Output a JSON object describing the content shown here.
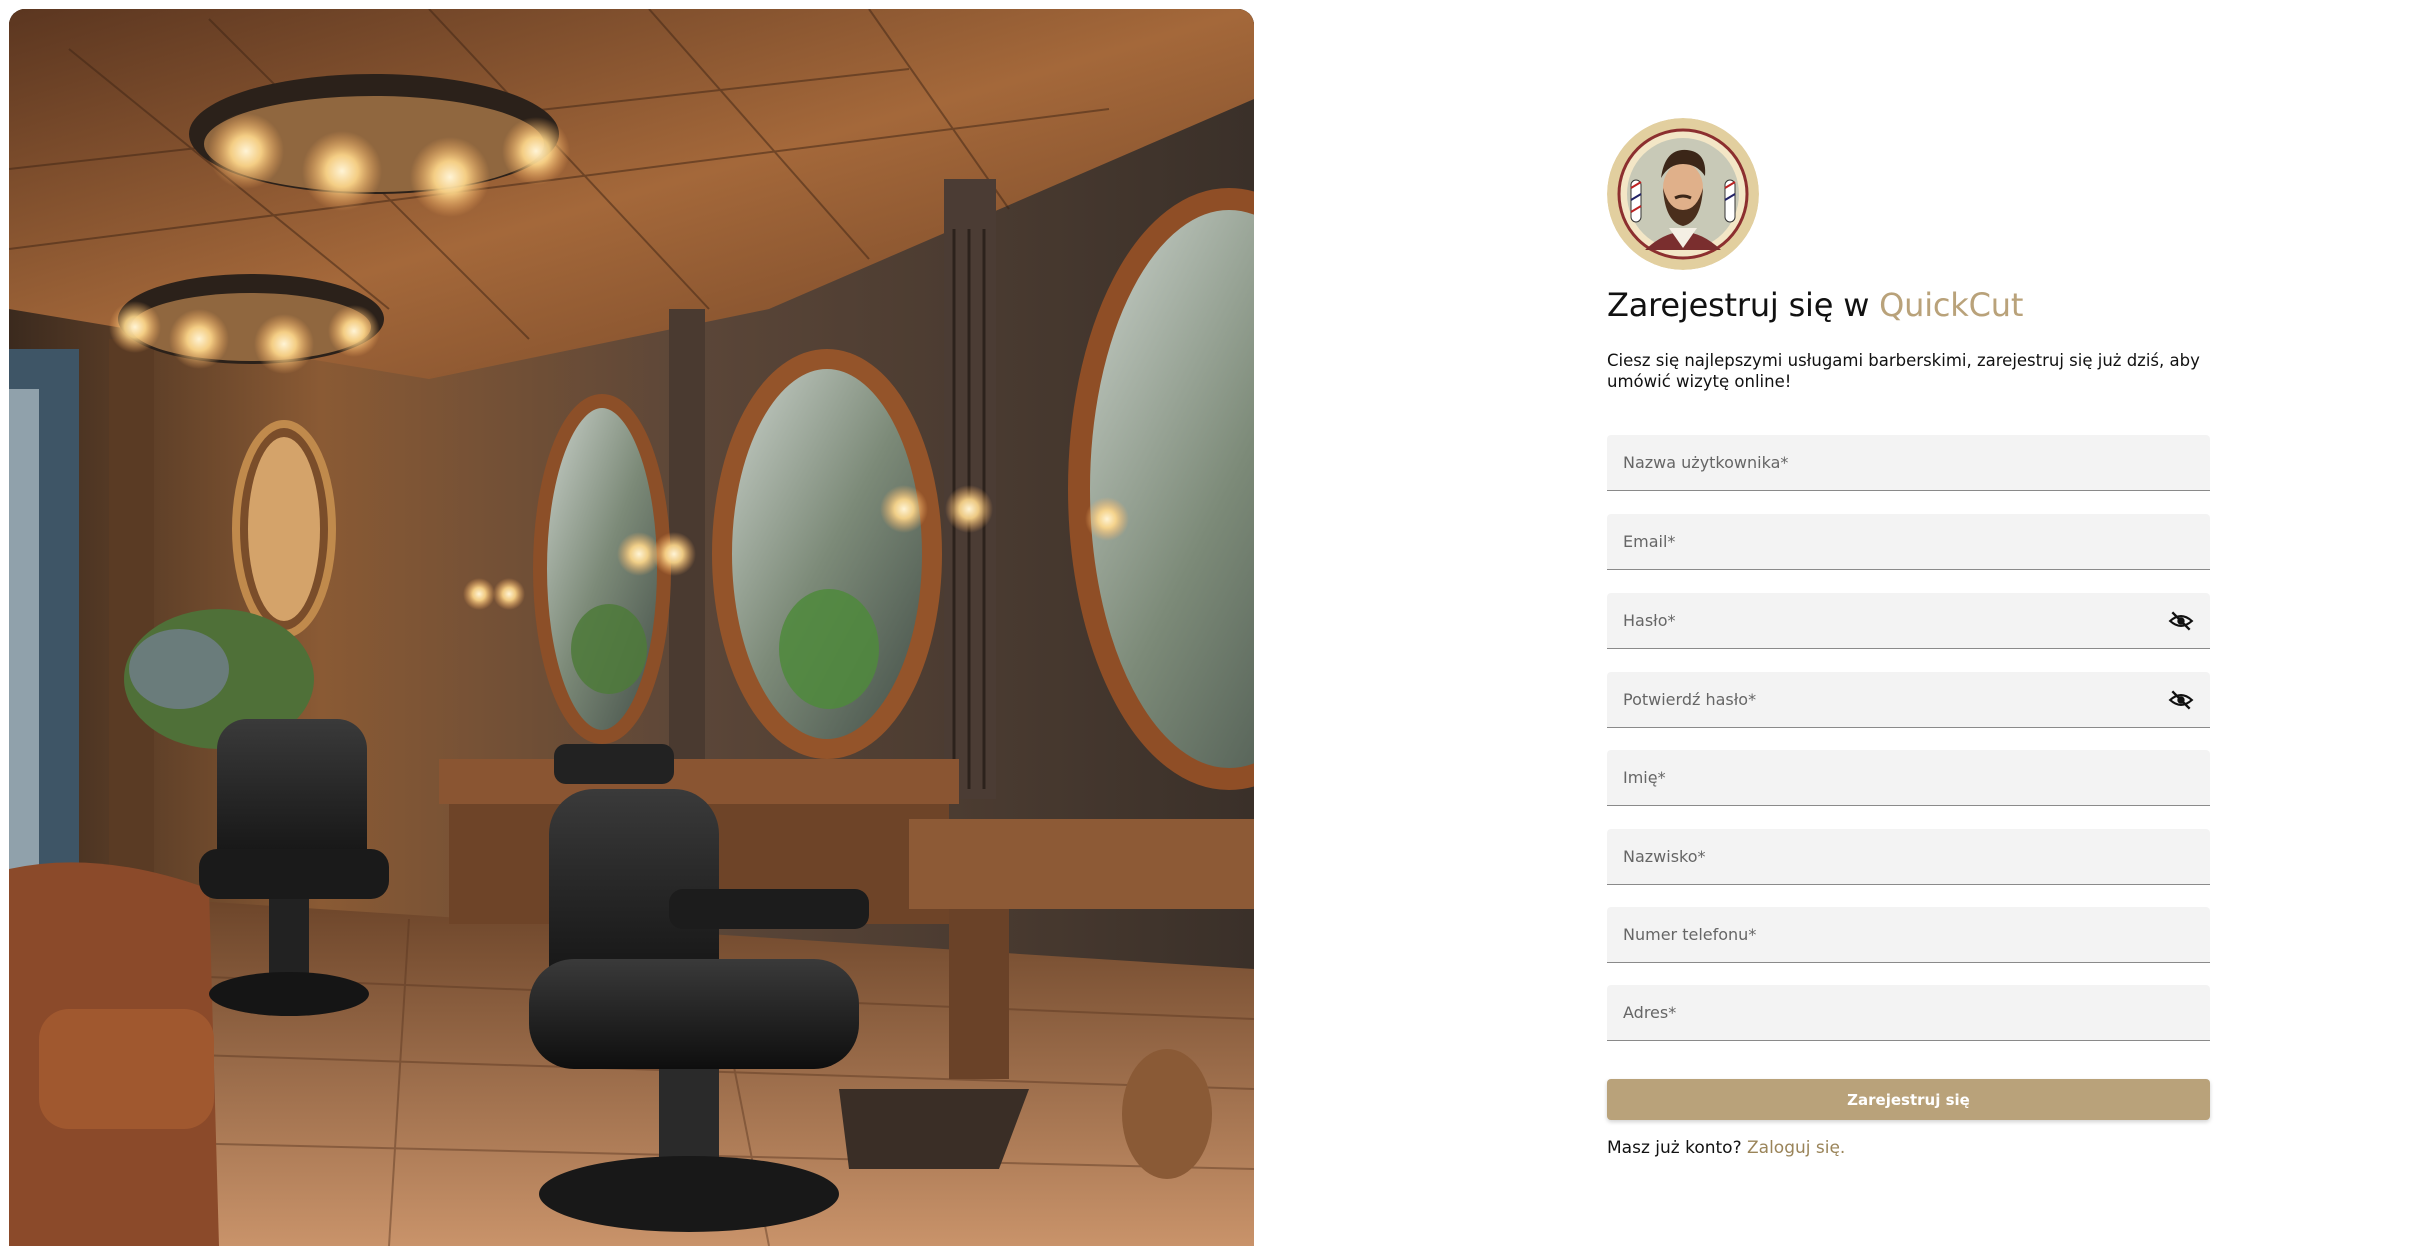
{
  "hero": {
    "image": "barbershop-interior-illustration"
  },
  "logo": {
    "image": "bearded-barber-emblem"
  },
  "header": {
    "title_prefix": "Zarejestruj się w ",
    "brand": "QuickCut"
  },
  "intro": "Ciesz się najlepszymi usługami barberskimi, zarejestruj się już dziś, aby umówić wizytę online!",
  "form": {
    "fields": {
      "username": {
        "placeholder": "Nazwa użytkownika*",
        "value": ""
      },
      "email": {
        "placeholder": "Email*",
        "value": ""
      },
      "password": {
        "placeholder": "Hasło*",
        "value": "",
        "icon": "eye-off-icon"
      },
      "confirm_password": {
        "placeholder": "Potwierdź hasło*",
        "value": "",
        "icon": "eye-off-icon"
      },
      "first_name": {
        "placeholder": "Imię*",
        "value": ""
      },
      "last_name": {
        "placeholder": "Nazwisko*",
        "value": ""
      },
      "phone": {
        "placeholder": "Numer telefonu*",
        "value": ""
      },
      "address": {
        "placeholder": "Adres*",
        "value": ""
      }
    },
    "submit_label": "Zarejestruj się"
  },
  "login_prompt": {
    "text": "Masz już konto? ",
    "link": "Zaloguj się."
  },
  "colors": {
    "accent": "#b9a27a",
    "link": "#9a8459",
    "field_background": "#f3f3f3"
  }
}
